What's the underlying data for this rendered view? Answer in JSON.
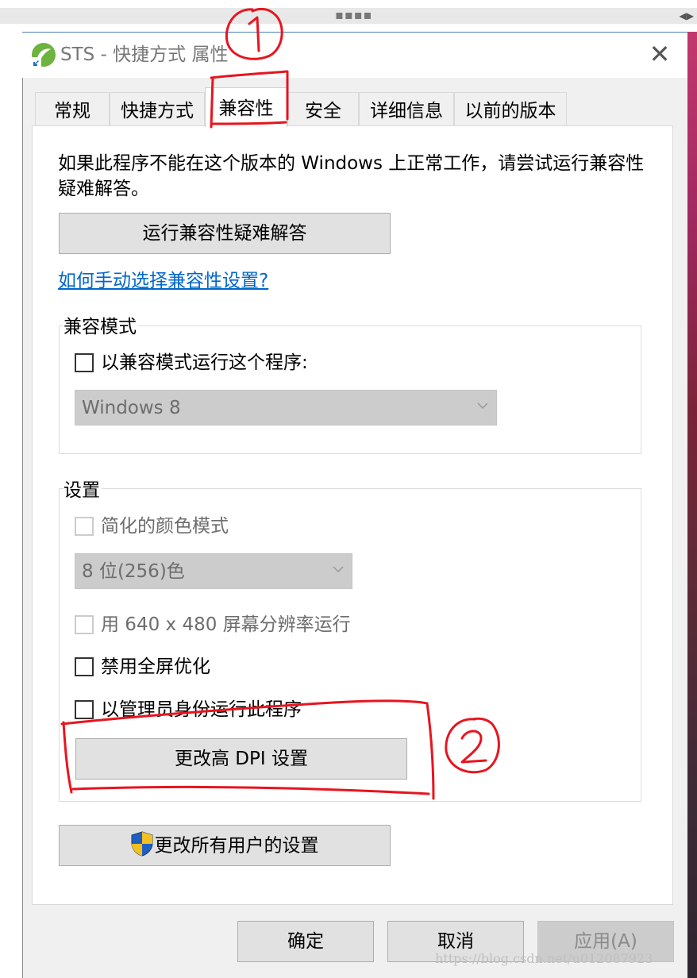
{
  "window": {
    "title": "STS - 快捷方式 属性",
    "close_symbol": "✕"
  },
  "browser_strip": {
    "grip": "▪▪▪▪",
    "arrows": "◀▶"
  },
  "tabs": [
    {
      "label": "常规",
      "active": false
    },
    {
      "label": "快捷方式",
      "active": false
    },
    {
      "label": "兼容性",
      "active": true
    },
    {
      "label": "安全",
      "active": false
    },
    {
      "label": "详细信息",
      "active": false
    },
    {
      "label": "以前的版本",
      "active": false
    }
  ],
  "compat": {
    "description": "如果此程序不能在这个版本的 Windows 上正常工作，请尝试运行兼容性疑难解答。",
    "troubleshoot_button": "运行兼容性疑难解答",
    "help_link": "如何手动选择兼容性设置?",
    "mode_group": {
      "legend": "兼容模式",
      "checkbox_label": "以兼容模式运行这个程序:",
      "checked": false,
      "select_value": "Windows 8"
    },
    "settings_group": {
      "legend": "设置",
      "reduced_color_label": "简化的颜色模式",
      "color_select_value": "8 位(256)色",
      "resolution_label": "用 640 x 480 屏幕分辨率运行",
      "fullscreen_opt_label": "禁用全屏优化",
      "admin_label": "以管理员身份运行此程序",
      "dpi_button": "更改高 DPI 设置"
    },
    "all_users_button": "更改所有用户的设置"
  },
  "footer": {
    "ok": "确定",
    "cancel": "取消",
    "apply": "应用(A)"
  },
  "annotations": {
    "mark1": "①",
    "mark2": "②",
    "color": "#e8141e"
  },
  "watermark": "https://blog.csdn.net/u012087923"
}
